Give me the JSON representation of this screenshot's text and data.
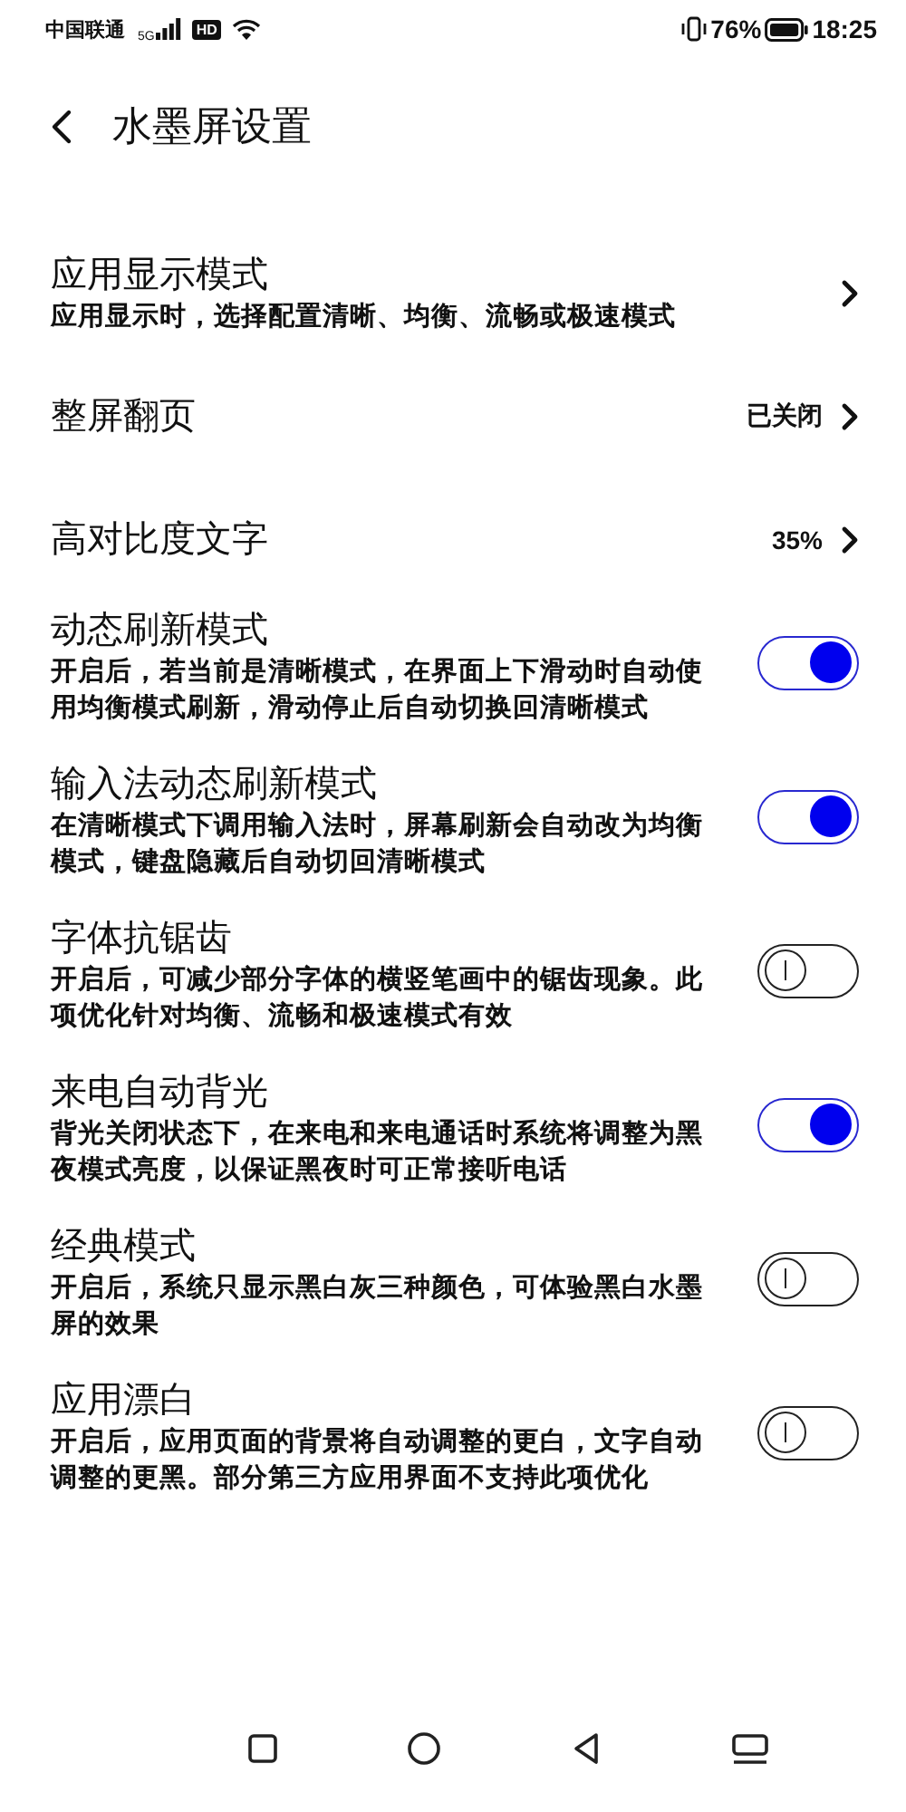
{
  "status_bar": {
    "carrier": "中国联通",
    "network": "5G",
    "hd_badge": "HD",
    "battery": "76%",
    "time": "18:25"
  },
  "header": {
    "title": "水墨屏设置"
  },
  "settings": [
    {
      "kind": "link",
      "title": "应用显示模式",
      "description": "应用显示时，选择配置清晰、均衡、流畅或极速模式"
    },
    {
      "kind": "link",
      "title": "整屏翻页",
      "value": "已关闭"
    },
    {
      "kind": "link",
      "title": "高对比度文字",
      "value": "35%"
    },
    {
      "kind": "toggle",
      "title": "动态刷新模式",
      "description": "开启后，若当前是清晰模式，在界面上下滑动时自动使用均衡模式刷新，滑动停止后自动切换回清晰模式",
      "on": true
    },
    {
      "kind": "toggle",
      "title": "输入法动态刷新模式",
      "description": "在清晰模式下调用输入法时，屏幕刷新会自动改为均衡模式，键盘隐藏后自动切回清晰模式",
      "on": true
    },
    {
      "kind": "toggle",
      "title": "字体抗锯齿",
      "description": "开启后，可减少部分字体的横竖笔画中的锯齿现象。此项优化针对均衡、流畅和极速模式有效",
      "on": false
    },
    {
      "kind": "toggle",
      "title": "来电自动背光",
      "description": "背光关闭状态下，在来电和来电通话时系统将调整为黑夜模式亮度，以保证黑夜时可正常接听电话",
      "on": true
    },
    {
      "kind": "toggle",
      "title": "经典模式",
      "description": "开启后，系统只显示黑白灰三种颜色，可体验黑白水墨屏的效果",
      "on": false
    },
    {
      "kind": "toggle",
      "title": "应用漂白",
      "description": "开启后，应用页面的背景将自动调整的更白，文字自动调整的更黑。部分第三方应用界面不支持此项优化",
      "on": false
    }
  ]
}
